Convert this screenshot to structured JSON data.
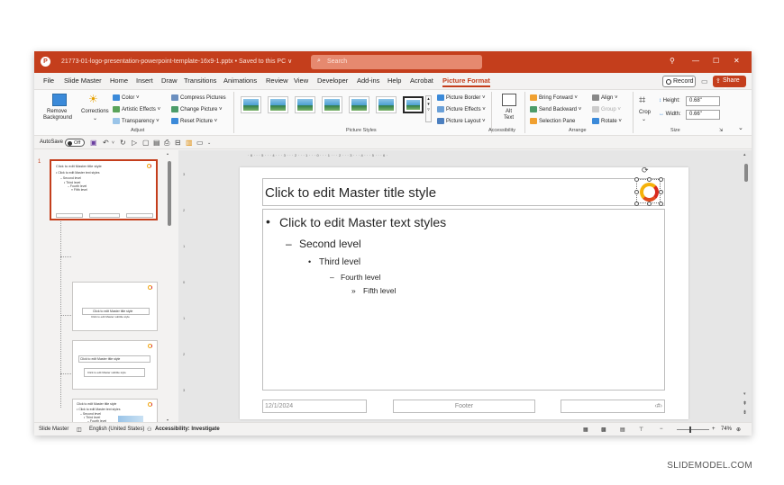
{
  "titlebar": {
    "app_logo": "P",
    "document_title": "21773-01-logo-presentation-powerpoint-template-16x9-1.pptx • Saved to this PC ∨",
    "search_placeholder": "Search",
    "lightbulb_icon": "lightbulb-icon",
    "minimize": "—",
    "maximize": "☐",
    "close": "✕"
  },
  "menu": {
    "tabs": [
      "File",
      "Slide Master",
      "Home",
      "Insert",
      "Draw",
      "Transitions",
      "Animations",
      "Review",
      "View",
      "Developer",
      "Add-ins",
      "Help",
      "Acrobat",
      "Picture Format"
    ],
    "active_tab": "Picture Format",
    "record_label": "Record",
    "share_label": "Share ⌄"
  },
  "ribbon": {
    "adjust": {
      "remove_background": [
        "Remove",
        "Background"
      ],
      "corrections": "Corrections",
      "color": "Color ˅",
      "artistic_effects": "Artistic Effects ˅",
      "transparency": "Transparency ˅",
      "compress_pictures": "Compress Pictures",
      "change_picture": "Change Picture ˅",
      "reset_picture": "Reset Picture ˅",
      "group_label": "Adjust"
    },
    "picture_styles": {
      "picture_border": "Picture Border ˅",
      "picture_effects": "Picture Effects ˅",
      "picture_layout": "Picture Layout ˅",
      "group_label": "Picture Styles"
    },
    "accessibility": {
      "alt_text": [
        "Alt",
        "Text"
      ],
      "group_label": "Accessibility"
    },
    "arrange": {
      "bring_forward": "Bring Forward ˅",
      "send_backward": "Send Backward ˅",
      "selection_pane": "Selection Pane",
      "align": "Align ˅",
      "group": "Group ˅",
      "rotate": "Rotate ˅",
      "group_label": "Arrange"
    },
    "size": {
      "crop": "Crop",
      "height_label": "Height:",
      "height_value": "0.68\"",
      "width_label": "Width:",
      "width_value": "0.66\"",
      "group_label": "Size"
    }
  },
  "qat": {
    "autosave_label": "AutoSave",
    "toggle_state": "Off"
  },
  "thumbnails": {
    "active_number": "1",
    "master": {
      "title": "Click to edit Master title style",
      "lines": [
        "• Click to edit Master text styles",
        "– Second level",
        "• Third level",
        "– Fourth level",
        "» Fifth level"
      ]
    },
    "layout1": {
      "title": "Click to edit Master title style",
      "subtitle": "Click to edit Master subtitle style"
    },
    "layout2": {
      "title": "Click to edit Master title style",
      "subtitle": "Click to edit Master subtitle style"
    },
    "layout3": {
      "title": "Click to edit Master title style",
      "line1": "• Click to edit Master text styles",
      "line2": "– Second level",
      "line3": "• Third level",
      "line4": "– Fourth level"
    }
  },
  "ruler": {
    "horizontal": "· 6 · · · 5 · · · 4 · · · 3 · · · 2 · · · 1 · · · 0 · · · 1 · · · 2 · · · 3 · · · 4 · · · 5 · · · 6 ·",
    "vertical": [
      "3",
      "2",
      "1",
      "0",
      "1",
      "2",
      "3"
    ]
  },
  "slide": {
    "title": "Click to edit Master title style",
    "level1": "Click to edit Master text styles",
    "level2": "Second level",
    "level3": "Third level",
    "level4": "Fourth level",
    "level5": "Fifth level",
    "bullet1": "•",
    "bullet2": "–",
    "bullet3": "•",
    "bullet4": "–",
    "bullet5": "»",
    "footer_date": "12/1/2024",
    "footer_text": "Footer",
    "footer_number": "‹#›"
  },
  "status": {
    "view": "Slide Master",
    "language": "English (United States)",
    "accessibility": "Accessibility: Investigate",
    "zoom": "74%"
  },
  "watermark": "SLIDEMODEL.COM",
  "colors": {
    "accent": "#c43e1c",
    "logo_yellow": "#f5b20a",
    "logo_red": "#d9291c"
  }
}
